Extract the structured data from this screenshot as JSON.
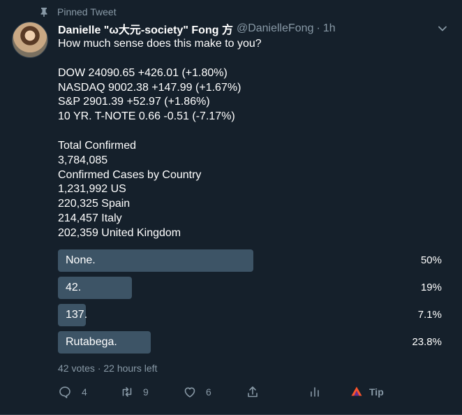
{
  "pinned_label": "Pinned Tweet",
  "author": {
    "name": "Danielle \"ω大元-society\" Fong 方",
    "handle": "@DanielleFong",
    "separator": "·",
    "time": "1h"
  },
  "text_lines": [
    "How much sense does this make to you?",
    "",
    "DOW 24090.65 +426.01 (+1.80%)",
    "NASDAQ 9002.38 +147.99 (+1.67%)",
    "S&P 2901.39 +52.97 (+1.86%)",
    "10 YR. T-NOTE 0.66 -0.51 (-7.17%)",
    "",
    "Total Confirmed",
    "3,784,085",
    "Confirmed Cases by Country",
    "1,231,992 US",
    "220,325 Spain",
    "214,457 Italy",
    "202,359 United Kingdom"
  ],
  "poll": {
    "options": [
      {
        "label": "None.",
        "percent_text": "50%",
        "percent": 50.0
      },
      {
        "label": "42.",
        "percent_text": "19%",
        "percent": 19.0
      },
      {
        "label": "137.",
        "percent_text": "7.1%",
        "percent": 7.1
      },
      {
        "label": "Rutabega.",
        "percent_text": "23.8%",
        "percent": 23.8
      }
    ],
    "meta": "42 votes · 22 hours left"
  },
  "actions": {
    "reply_count": "4",
    "retweet_count": "9",
    "like_count": "6",
    "tip_label": "Tip"
  },
  "colors": {
    "background": "#15202b",
    "muted": "#8899a6",
    "poll_bar": "#3d5466",
    "brave_orange": "#fb542b",
    "brave_purple": "#662d91"
  }
}
